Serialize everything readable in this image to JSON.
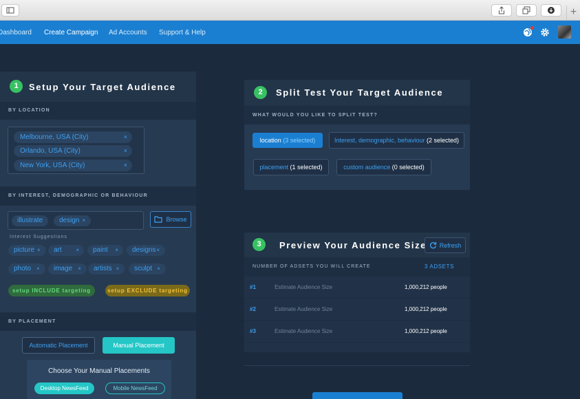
{
  "nav": {
    "dashboard": "Dashboard",
    "create_campaign": "Create Campaign",
    "ad_accounts": "Ad Accounts",
    "support": "Support & Help"
  },
  "step1": {
    "number": "1",
    "title": "Setup Your Target Audience",
    "by_location": "BY LOCATION",
    "locations": [
      "Melbourne, USA (City)",
      "Orlando, USA (City)",
      "New York, USA (City)"
    ],
    "by_interest": "BY INTEREST, DEMOGRAPHIC OR BEHAVIOUR",
    "interests": [
      "illustrate",
      "design"
    ],
    "browse_label": "Browse",
    "suggestions_label": "Interest Suggestions",
    "suggestions": [
      "picture",
      "art",
      "paint",
      "designs",
      "photo",
      "image",
      "artists",
      "sculpt"
    ],
    "include_label": "setup INCLUDE targeting",
    "exclude_label": "setup EXCLUDE targeting",
    "by_placement": "BY PLACEMENT",
    "automatic_label": "Automatic Placement",
    "manual_label": "Manual Placement",
    "choose_label": "Choose Your Manual Placements",
    "desktop_label": "Desktop NewsFeed",
    "mobile_label": "Mobile NewsFeed"
  },
  "step2": {
    "number": "2",
    "title": "Split Test Your Target Audience",
    "question": "WHAT WOULD YOU LIKE TO SPLIT TEST?",
    "location_btn": "location",
    "location_count": "(3 selected)",
    "interest_btn": "Interest, demographic, behaviour",
    "interest_count": "(2 selected)",
    "placement_btn": "placement",
    "placement_count": "(1 selected)",
    "custom_btn": "custom audience",
    "custom_count": "(0 selected)"
  },
  "step3": {
    "number": "3",
    "title": "Preview Your Audience Sizes",
    "refresh_label": "Refresh",
    "adsets_label": "NUMBER OF ADSETS YOU WILL CREATE",
    "adsets_value": "3 ADSETS",
    "rows": [
      {
        "num": "#1",
        "label": "Estimate Audience Size",
        "value": "1,000,212 people"
      },
      {
        "num": "#2",
        "label": "Estimate Audience Size",
        "value": "1,000,212 people"
      },
      {
        "num": "#3",
        "label": "Estimate Audience Size",
        "value": "1,000,212 people"
      }
    ]
  },
  "colors": {
    "nav_blue": "#1b7fd1",
    "step_green": "#38c163",
    "teal": "#24c6c6",
    "link_blue": "#3ea0f2",
    "include_green": "#2f6b3c",
    "exclude_amber": "#7a6a1a"
  }
}
